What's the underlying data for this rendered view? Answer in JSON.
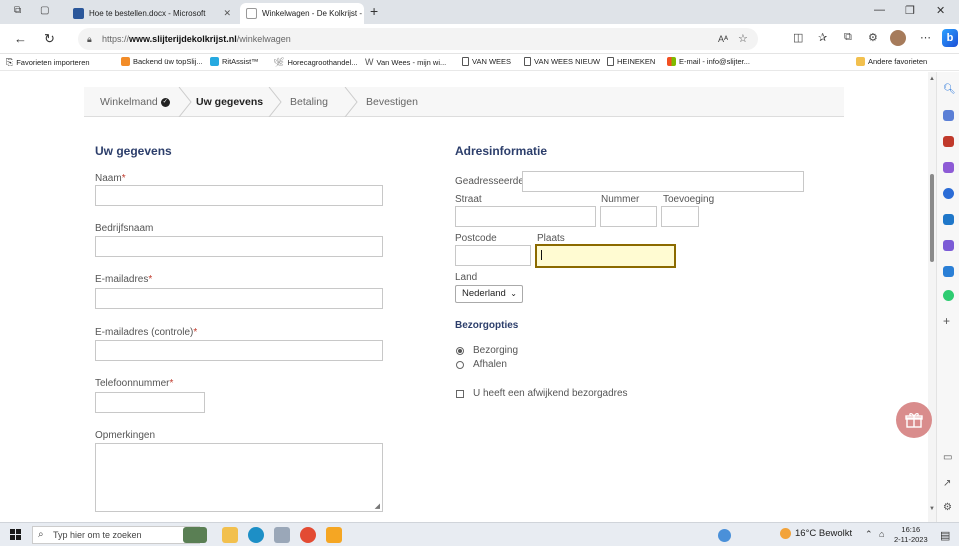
{
  "browser": {
    "tabs": [
      {
        "title": "Hoe te bestellen.docx - Microsoft",
        "icon": "word-icon",
        "color": "#2b579a"
      },
      {
        "title": "Winkelwagen - De Kolkrijst - üw",
        "icon": "site-icon",
        "color": "#6a6a6a"
      }
    ],
    "url_prefix": "https://",
    "url_domain": "www.slijterijdekolkrijst.nl",
    "url_path": "/winkelwagen",
    "read_aloud": "Aᴬ",
    "bookmarks": [
      {
        "label": "Favorieten importeren"
      },
      {
        "label": "Backend üw topSlij...",
        "color": "#f28c28"
      },
      {
        "label": "RitAssist™",
        "color": "#26a9e0"
      },
      {
        "label": "Horecagroothandel...",
        "color": "#888888"
      },
      {
        "label": "Van Wees - mijn wi...",
        "color": "#555555"
      },
      {
        "label": "VAN WEES"
      },
      {
        "label": "VAN WEES NIEUW"
      },
      {
        "label": "HEINEKEN"
      },
      {
        "label": "E-mail - info@slijter...",
        "color": "#f25022"
      }
    ],
    "other_favorites": "Andere favorieten"
  },
  "checkout_steps": [
    {
      "label": "Winkelmand"
    },
    {
      "label": "Uw gegevens"
    },
    {
      "label": "Betaling"
    },
    {
      "label": "Bevestigen"
    }
  ],
  "left_form": {
    "title": "Uw gegevens",
    "naam": "Naam",
    "bedrijfsnaam": "Bedrijfsnaam",
    "email": "E-mailadres",
    "email_control": "E-mailadres (controle)",
    "telefoon": "Telefoonnummer",
    "opmerkingen": "Opmerkingen",
    "required_mark": "*"
  },
  "address": {
    "title": "Adresinformatie",
    "geadresseerde": "Geadresseerde",
    "straat": "Straat",
    "nummer": "Nummer",
    "toevoeging": "Toevoeging",
    "postcode": "Postcode",
    "plaats": "Plaats",
    "land": "Land",
    "land_value": "Nederland"
  },
  "delivery": {
    "title": "Bezorgopties",
    "option1": "Bezorging",
    "option2": "Afhalen",
    "selected": "Bezorging",
    "alt_address": "U heeft een afwijkend bezorgadres"
  },
  "taskbar": {
    "search_placeholder": "Typ hier om te zoeken",
    "weather": "16°C Bewolkt",
    "time": "16:16",
    "date": "2-11-2023"
  }
}
